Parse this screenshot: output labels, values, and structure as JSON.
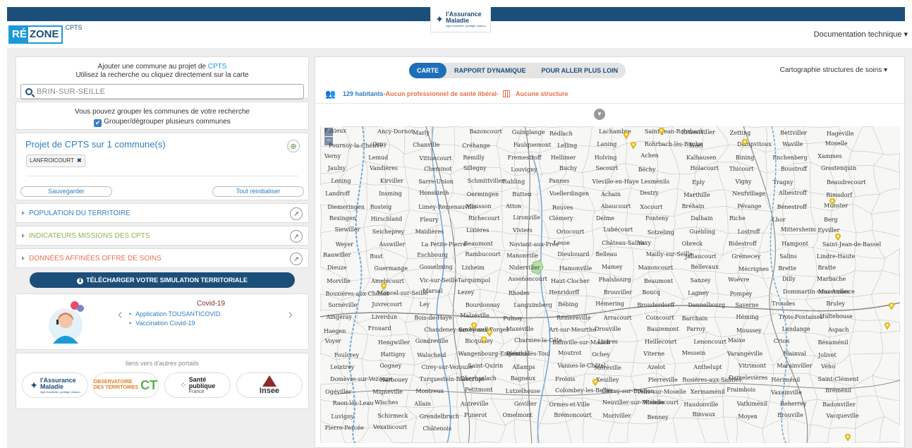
{
  "header": {
    "brand_re": "RÉ",
    "brand_zone": "ZONE",
    "brand_suffix": "CPTS",
    "partner_logo": {
      "name": "l'Assurance",
      "name2": "Maladie",
      "tagline": "Agir ensemble, protéger chacun"
    },
    "doc_menu": "Documentation technique ▾"
  },
  "add_commune": {
    "line1_prefix": "Ajouter une commune au projet de ",
    "line1_link": "CPTS",
    "line2": "Utilisez la recherche ou cliquez directement sur la carte",
    "search_value": "BRIN-SUR-SEILLE"
  },
  "grouping": {
    "text": "Vous pouvez grouper les communes de votre recherche",
    "checkbox_label": "Grouper/dégrouper plusieurs communes",
    "checked": true
  },
  "project": {
    "title": "Projet de CPTS sur 1 commune(s)",
    "chip": "LANFROICOURT",
    "save_label": "Sauvegarder",
    "reset_label": "Tout réinitialiser"
  },
  "sections": [
    {
      "label": "POPULATION DU TERRITOIRE",
      "color": "#2f7fc1"
    },
    {
      "label": "INDICATEURS MISSIONS DES CPTS",
      "color": "#8ab34a"
    },
    {
      "label": "DONNÉES AFFINÉES OFFRE DE SOINS",
      "color": "#e8714d"
    }
  ],
  "download_label": "TÉLÉCHARGER VOTRE SIMULATION TERRITORIALE",
  "covid": {
    "title": "Covid-19",
    "items": [
      "Application TOUSANTICOVID",
      "Vaccination Covid-19"
    ]
  },
  "portals": {
    "title": "liens vers d'autres portails",
    "am": {
      "name": "l'Assurance",
      "name2": "Maladie",
      "tagline": "Agir ensemble, protéger chacun"
    },
    "ot": {
      "line1": "OBSERVATOIRE",
      "line2": "DES TERRITOIRES"
    },
    "sp": {
      "line1": "Santé",
      "line2": "publique",
      "line3": "France"
    },
    "insee": "Insee"
  },
  "tabs": [
    {
      "label": "CARTE",
      "active": true
    },
    {
      "label": "RAPPORT DYNAMIQUE",
      "active": false
    },
    {
      "label": "POUR ALLER PLUS LOIN",
      "active": false
    }
  ],
  "cartography_menu": "Cartographie structures de soins ▾",
  "info": {
    "inhabitants": "129 habitants",
    "separator": " - ",
    "no_pro": "Aucun professionnel de santé libéral",
    "dash": " -",
    "no_structure": "Aucune structure"
  },
  "map": {
    "zoom_in": "+",
    "zoom_out": "−",
    "places": [
      "Paxieux",
      "Ancy-Dornot",
      "Marly",
      "Bazoncourt",
      "Guinglange",
      "Rédlach",
      "Lachambre",
      "Saint-Jean-Rohrbach",
      "Ernestviller",
      "Zetting",
      "Bettviller",
      "Hagéville",
      "Pournoy-la-Chétive",
      "Orny",
      "Chanville",
      "Créhange",
      "Faulquemont",
      "Lelling",
      "Laning",
      "Rohrbach-lès-Bitche",
      "Woël",
      "Dampvitoux",
      "Waville",
      "Moselle",
      "Verny",
      "Lemud",
      "Vittoncourt",
      "Remilly",
      "Fremestroff",
      "Hellimer",
      "Holving",
      "Achen",
      "Kalhausen",
      "Bining",
      "Enchenberg",
      "Xammes",
      "Jaulny",
      "Vandières",
      "Cheminot",
      "Sillegny",
      "Louvigny",
      "Buchy",
      "Secourt",
      "Béchy",
      "Holacourt",
      "Thicourt",
      "Boustroff",
      "Grostenquin",
      "Lening",
      "Kirviller",
      "Sarre-Union",
      "Schmittviller",
      "Rahling",
      "Pannes",
      "Vieville-en-Haye",
      "Lesménils",
      "Eply",
      "Vigny",
      "Tragny",
      "Beaudrecourt",
      "Landroff",
      "Insming",
      "Honskirch",
      "Oermingen",
      "Butten",
      "Voellerdingen",
      "Achain",
      "Destry",
      "Marthille",
      "Neufvillage",
      "Albestroff",
      "Rimsdorf",
      "Diemeringen",
      "Rosteig",
      "Limey-Remenauville",
      "Mousson",
      "Atton",
      "Rouves",
      "Abaucourt",
      "Xocourt",
      "Bréhain",
      "Pévange",
      "Bénestroff",
      "Munster",
      "Rexingen",
      "Hirschland",
      "Fleury",
      "Richecourt",
      "Lironville",
      "Clémery",
      "Delme",
      "Fonteny",
      "Dalhain",
      "Riche",
      "Lhor",
      "Berg",
      "Siewiller",
      "Seicheprey",
      "Maidières",
      "Lixières",
      "Viviers",
      "Oriocourt",
      "Lubécourt",
      "Sotzeling",
      "Guébling",
      "Lostroff",
      "Mittersheim",
      "Eyviller",
      "Weyer",
      "Asswiller",
      "La Petite-Pierre",
      "Beaumont",
      "Noviant-aux-Prés",
      "Lesse",
      "Château-Salins",
      "Vaxy",
      "Obreck",
      "Bidestroff",
      "Hampont",
      "Saint-Jean-de-Bassel",
      "Rauwiller",
      "Bust",
      "Eschbourg",
      "Rambucourt",
      "Manonville",
      "Dieulouard",
      "Belleau",
      "Mailly-sur-Seille",
      "Jallaucourt",
      "Grémecey",
      "Salins",
      "Lindre-Haute",
      "Dieuze",
      "Guermange",
      "Gosselming",
      "Lixheim",
      "Niderviller",
      "Hamonville",
      "Mamey",
      "Manoncourt",
      "Bellevaux",
      "Mécrignes",
      "Brette",
      "Bratte",
      "Morville",
      "Amelécourt",
      "Vic-sur-Seille",
      "Tarquimpol",
      "Assenoncourt",
      "Haut-Clocher",
      "Phalsbourg",
      "Beaumont",
      "Sanzey",
      "Woëvre",
      "Dilly",
      "Marbache",
      "Bouxières-aux-Chênes",
      "Moncel-sur-Seille",
      "Marsal",
      "Lezey",
      "Rhodes",
      "Henridorff",
      "Brouviller",
      "Boucq",
      "Lagney",
      "Pompey",
      "Dommartin-sous-Amance",
      "Mazerulles",
      "Sornéville",
      "Juvrecourt",
      "Ley",
      "Bourdonnay",
      "Languimberg",
      "Bébing",
      "Hémering",
      "Brouderdorff",
      "Dannelbourg",
      "Saverne",
      "Troudes",
      "Bruley",
      "Aingeray",
      "Liverdun",
      "Bois-de-Haye",
      "Malzéville",
      "Pulnoy",
      "Rémeréville",
      "Arracourt",
      "Coincourt",
      "Barchain",
      "Héming",
      "Trois-Fontaines",
      "Hultehouse",
      "Haegen",
      "Frouard",
      "Chaudeney-sur-Moselle",
      "Sexey-aux-Forges",
      "Maxéville",
      "Art-sur-Meurthe",
      "Drouville",
      "Bauzemont",
      "Parroy",
      "Moussey",
      "Landange",
      "Aspach",
      "Voyer",
      "Hengwiller",
      "Gondreville",
      "Bicqueley",
      "Charmes-la-Côte",
      "Bainville-sur-Madon",
      "Ludres",
      "Heillecourt",
      "Lenoncourt",
      "Maixe",
      "Crion",
      "Bénaménil",
      "Foulcrey",
      "Hattigny",
      "Walscheid",
      "Wangenbourg-Engenthal",
      "Blénod-lès-Toul",
      "Moutrot",
      "Ochey",
      "Viterne",
      "Messein",
      "Varangéville",
      "Flainval",
      "Jolivet",
      "Leintrey",
      "Gogney",
      "Cirey-sur-Vezouze",
      "Saint-Quirin",
      "Allamps",
      "Vannes-le-Châtel",
      "Méréville",
      "Azelot",
      "Anthelupt",
      "Vitrimont",
      "Marainviller",
      "Vého",
      "Domèvre-sur-Vezouze",
      "Harbouey",
      "Turquestein-Blancrupt",
      "Oberhaslach",
      "Bagneux",
      "Frolois",
      "Xeuilley",
      "Pierreville",
      "Rosières-aux-Salines",
      "Damelevières",
      "Hériménil",
      "Saint-Clément",
      "Ogéviller",
      "Migneville",
      "Montreux",
      "Petitmont",
      "Lutzelhouse",
      "Colombey-les-Belles",
      "Clérey-sur-Brenon",
      "Velle-sur-Moselle",
      "Xermaménil",
      "Fraimbois",
      "Vaxainville",
      "Bréménil",
      "Raon-lès-Leau",
      "Wisches",
      "Allain",
      "Autreville",
      "Goviller",
      "Ormes-et-Ville",
      "Neuviller-sur-Moselle",
      "Méhoncourt",
      "Haudonville",
      "Vathiménil",
      "Reherrey",
      "Badonviller",
      "Luvigny",
      "Schirmeck",
      "Grendelbruch",
      "Punerot",
      "Omelmont",
      "Brémoncourt",
      "Moriviller",
      "Benney",
      "Binvaux",
      "Moyen",
      "Brouville",
      "Vacqueville",
      "Pierre-Percée",
      "Vexaincourt",
      "Châtenois"
    ]
  }
}
